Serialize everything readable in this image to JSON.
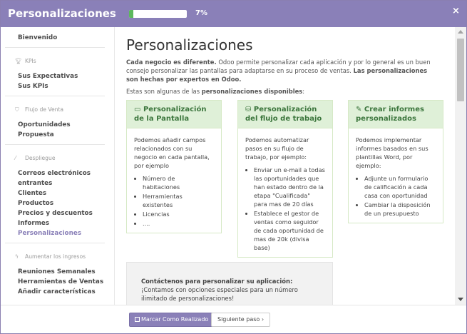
{
  "header": {
    "title": "Personalizaciones",
    "progress_percent": 7,
    "progress_label": "7%",
    "close_glyph": "×"
  },
  "sidebar": {
    "welcome": "Bienvenido",
    "sections": [
      {
        "heading": "KPIs",
        "icon": "trophy-icon",
        "items": [
          "Sus Expectativas",
          "Sus KPIs"
        ]
      },
      {
        "heading": "Flujo de Venta",
        "icon": "tag-icon",
        "items": [
          "Oportunidades",
          "Propuesta"
        ]
      },
      {
        "heading": "Despliegue",
        "icon": "magic-wand-icon",
        "items": [
          "Correos electrónicos",
          "entrantes",
          "Clientes",
          "Productos",
          "Precios y descuentos",
          "Informes",
          "Personalizaciones"
        ]
      },
      {
        "heading": "Aumentar los ingresos",
        "icon": "bolt-icon",
        "items": [
          "Reuniones Semanales",
          "Herramientas de Ventas",
          "Añadir características"
        ]
      }
    ],
    "active_item": "Personalizaciones"
  },
  "main": {
    "title": "Personalizaciones",
    "intro_bold_1": "Cada negocio es diferente.",
    "intro_text": " Odoo permite personalizar cada aplicación y por lo general es un buen consejo personalizar las pantallas para adaptarse en su proceso de ventas. ",
    "intro_bold_2": "Las personalizaciones son hechas por expertos en Odoo.",
    "sub_text": "Estas son algunas de las ",
    "sub_bold": "personalizaciones disponibles",
    "sub_colon": ":",
    "cards": [
      {
        "title": "Personalización de la Pantalla",
        "icon": "desktop-icon",
        "body": "Podemos añadir campos relacionados con su negocio en cada pantalla, por ejemplo",
        "bullets": [
          "Número de habitaciones",
          "Herramientas existentes",
          "Licencias",
          "...."
        ]
      },
      {
        "title": "Personalización del flujo de trabajo",
        "icon": "sitemap-icon",
        "body": "Podemos automatizar pasos en su flujo de trabajo, por ejemplo:",
        "bullets": [
          "Enviar un e-mail a todas las oportunidades que han estado dentro de la etapa \"Cualificada\" para mas de 20 días",
          "Establece el gestor de ventas como seguidor de cada oportunidad de mas de 20k (divisa base)"
        ]
      },
      {
        "title": "Crear informes personalizados",
        "icon": "edit-icon",
        "body": "Podemos implementar informes basados en sus plantillas Word, por ejemplo:",
        "bullets": [
          "Adjunte un formulario de calificación a cada casa con oportunidad",
          "Cambiar la disposición de un presupuesto"
        ]
      }
    ],
    "contact_title": "Contáctenos para personalizar su aplicación:",
    "contact_text": "¡Contamos con opciones especiales para un número ilimitado de personalizaciones!"
  },
  "footer": {
    "mark_done_label": "Marcar Como Realizado",
    "next_label": "Siguiente paso",
    "next_glyph": "›"
  },
  "colors": {
    "header": "#8a80b8",
    "card_header_bg": "#dff0d8",
    "card_header_text": "#3c763d",
    "progress_fill": "#5cb85c"
  }
}
